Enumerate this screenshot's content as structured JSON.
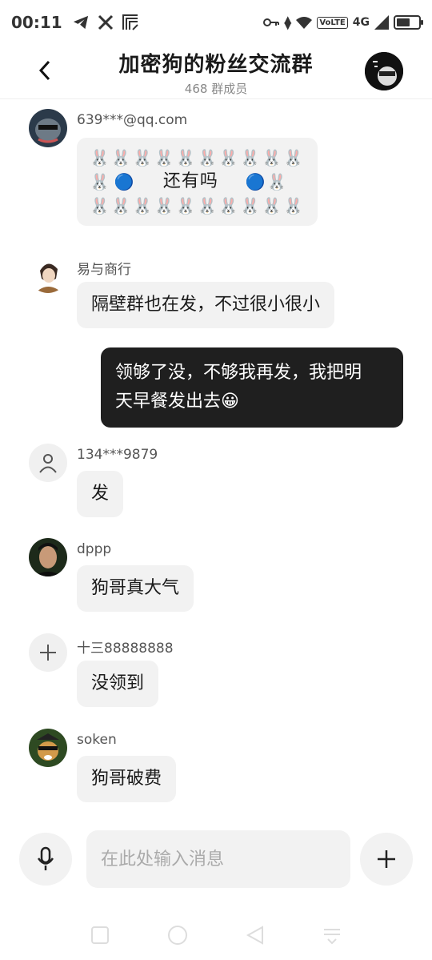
{
  "status_bar": {
    "time": "00:11",
    "network": "4G",
    "volte": "VoLTE",
    "battery_level": 0.6
  },
  "header": {
    "title": "加密狗的粉丝交流群",
    "member_count": "468 群成员"
  },
  "messages": [
    {
      "sender": "639***@qq.com",
      "text_middle": "还有吗",
      "rabbit_row": "🐰🐰🐰🐰🐰🐰🐰🐰🐰🐰",
      "side_emoji": "🔵"
    },
    {
      "sender": "易与商行",
      "text": "隔壁群也在发，不过很小很小"
    },
    {
      "mine": true,
      "line1": "领够了没，不够我再发，我把明",
      "line2": "天早餐发出去😀"
    },
    {
      "sender": "134***9879",
      "text": "发"
    },
    {
      "sender": "dppp",
      "text": "狗哥真大气"
    },
    {
      "sender": "十三88888888",
      "text": "没领到"
    },
    {
      "sender": "soken",
      "text": "狗哥破费"
    }
  ],
  "input": {
    "placeholder": "在此处输入消息"
  },
  "colors": {
    "bubble_other": "#f2f2f2",
    "bubble_mine": "#1f1f1f"
  }
}
